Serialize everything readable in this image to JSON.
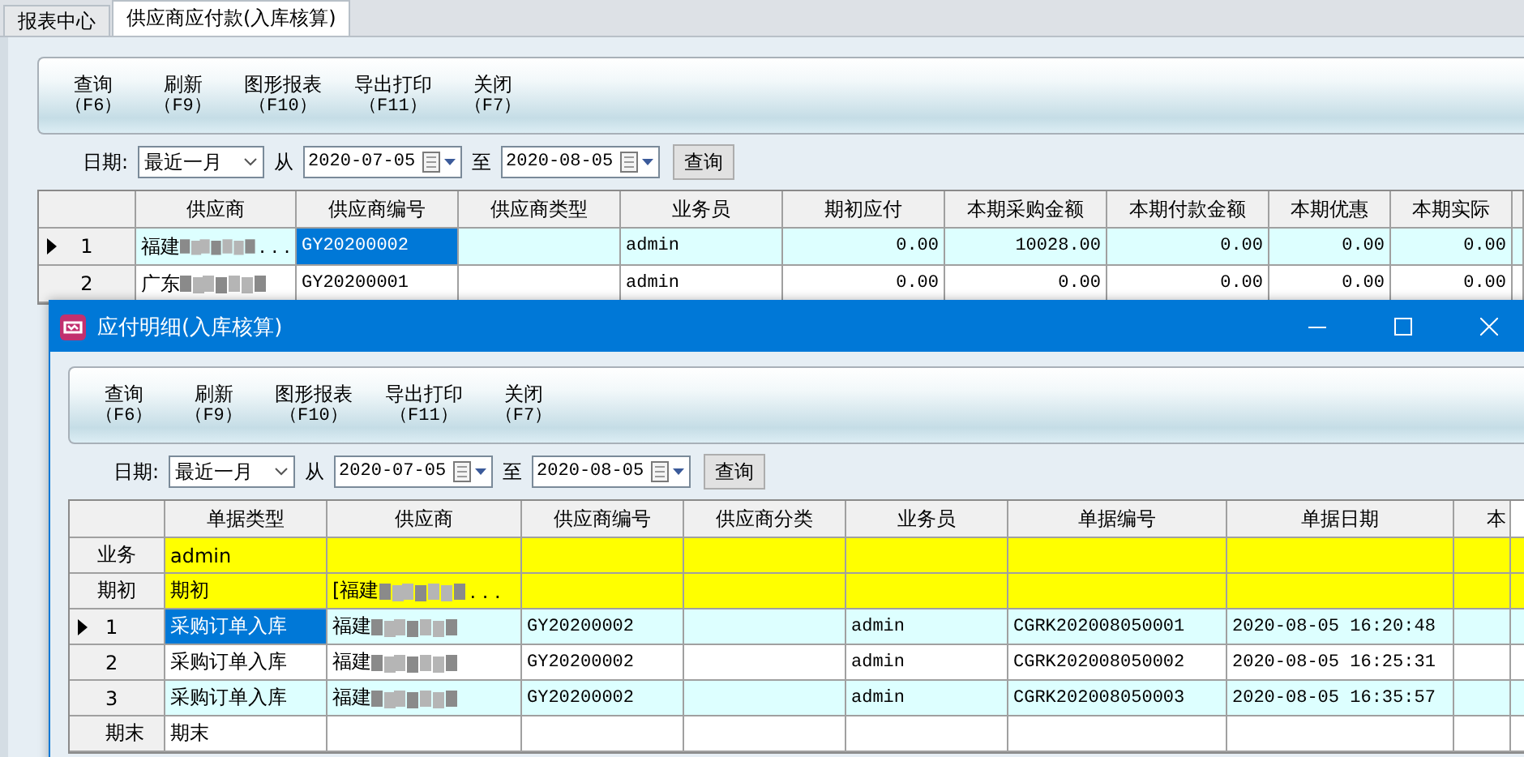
{
  "tabs": [
    {
      "label": "报表中心",
      "selected": false
    },
    {
      "label": "供应商应付款(入库核算)",
      "selected": true
    }
  ],
  "main": {
    "toolbar": [
      {
        "label": "查询",
        "key": "（F6）"
      },
      {
        "label": "刷新",
        "key": "（F9）"
      },
      {
        "label": "图形报表",
        "key": "（F10）"
      },
      {
        "label": "导出打印",
        "key": "（F11）"
      },
      {
        "label": "关闭",
        "key": "（F7）"
      }
    ],
    "filter": {
      "label": "日期:",
      "range": "最近一月",
      "from_label": "从",
      "from": "2020-07-05",
      "to_label": "至",
      "to": "2020-08-05",
      "button": "查询"
    },
    "table": {
      "columns": [
        {
          "label": "供应商",
          "kind": "name"
        },
        {
          "label": "供应商编号",
          "kind": "code"
        },
        {
          "label": "供应商类型",
          "kind": "name"
        },
        {
          "label": "业务员",
          "kind": "code"
        },
        {
          "label": "期初应付",
          "kind": "amount"
        },
        {
          "label": "本期采购金额",
          "kind": "amount"
        },
        {
          "label": "本期付款金额",
          "kind": "amount"
        },
        {
          "label": "本期优惠",
          "kind": "amount"
        },
        {
          "label": "本期实际",
          "kind": "amount"
        }
      ],
      "rows": [
        {
          "header": "1",
          "current": true,
          "color": "#ddffff",
          "cells": [
            {
              "text": "福建",
              "redacted": true,
              "trail": ". . .",
              "selected": false
            },
            {
              "text": "GY20200002",
              "selected": true
            },
            {
              "selected": false
            },
            {
              "text": "admin",
              "selected": false
            },
            {
              "text": "0.00",
              "selected": false
            },
            {
              "text": "10028.00",
              "selected": false
            },
            {
              "text": "0.00",
              "selected": false
            },
            {
              "text": "0.00",
              "selected": false
            },
            {
              "text": "0.00",
              "selected": false
            }
          ]
        },
        {
          "header": "2",
          "current": false,
          "color": "#ffffff",
          "cells": [
            {
              "text": "广东",
              "redacted": true,
              "selected": false
            },
            {
              "text": "GY20200001",
              "selected": false
            },
            {
              "selected": false
            },
            {
              "text": "admin",
              "selected": false
            },
            {
              "text": "0.00",
              "selected": false
            },
            {
              "text": "0.00",
              "selected": false
            },
            {
              "text": "0.00",
              "selected": false
            },
            {
              "text": "0.00",
              "selected": false
            },
            {
              "text": "0.00",
              "selected": false
            }
          ]
        }
      ]
    }
  },
  "dialog": {
    "title": "应付明细(入库核算)",
    "toolbar": [
      {
        "label": "查询",
        "key": "（F6）"
      },
      {
        "label": "刷新",
        "key": "（F9）"
      },
      {
        "label": "图形报表",
        "key": "（F10）"
      },
      {
        "label": "导出打印",
        "key": "（F11）"
      },
      {
        "label": "关闭",
        "key": "（F7）"
      }
    ],
    "filter": {
      "label": "日期:",
      "range": "最近一月",
      "from_label": "从",
      "from": "2020-07-05",
      "to_label": "至",
      "to": "2020-08-05",
      "button": "查询"
    },
    "table": {
      "columns": [
        {
          "label": "单据类型",
          "kind": "name"
        },
        {
          "label": "供应商",
          "kind": "name"
        },
        {
          "label": "供应商编号",
          "kind": "code"
        },
        {
          "label": "供应商分类",
          "kind": "name"
        },
        {
          "label": "业务员",
          "kind": "code"
        },
        {
          "label": "单据编号",
          "kind": "code"
        },
        {
          "label": "单据日期",
          "kind": "code"
        },
        {
          "label": "本",
          "kind": "name"
        }
      ],
      "rows": [
        {
          "header": "业务",
          "current": false,
          "color": "#ffff00",
          "cells": [
            {
              "text": "admin",
              "selected": false
            },
            {
              "selected": false
            },
            {
              "selected": false
            },
            {
              "selected": false
            },
            {
              "selected": false
            },
            {
              "selected": false
            },
            {
              "selected": false
            },
            {
              "selected": false
            }
          ]
        },
        {
          "header": "期初",
          "current": false,
          "color": "#ffff00",
          "cells": [
            {
              "text": "期初",
              "selected": false
            },
            {
              "text": "[福建",
              "redacted": true,
              "trail": ". . .",
              "selected": false
            },
            {
              "selected": false
            },
            {
              "selected": false
            },
            {
              "selected": false
            },
            {
              "selected": false
            },
            {
              "selected": false
            },
            {
              "selected": false
            }
          ]
        },
        {
          "header": "1",
          "current": true,
          "color": "#ddffff",
          "cells": [
            {
              "text": "采购订单入库",
              "selected": true
            },
            {
              "text": "福建",
              "redacted": true,
              "selected": false
            },
            {
              "text": "GY20200002",
              "selected": false
            },
            {
              "selected": false
            },
            {
              "text": "admin",
              "selected": false
            },
            {
              "text": "CGRK202008050001",
              "selected": false
            },
            {
              "text": "2020-08-05 16:20:48",
              "selected": false
            },
            {
              "selected": false
            }
          ]
        },
        {
          "header": "2",
          "current": false,
          "color": "#ffffff",
          "cells": [
            {
              "text": "采购订单入库",
              "selected": false
            },
            {
              "text": "福建",
              "redacted": true,
              "selected": false
            },
            {
              "text": "GY20200002",
              "selected": false
            },
            {
              "selected": false
            },
            {
              "text": "admin",
              "selected": false
            },
            {
              "text": "CGRK202008050002",
              "selected": false
            },
            {
              "text": "2020-08-05 16:25:31",
              "selected": false
            },
            {
              "selected": false
            }
          ]
        },
        {
          "header": "3",
          "current": false,
          "color": "#ddffff",
          "cells": [
            {
              "text": "采购订单入库",
              "selected": false
            },
            {
              "text": "福建",
              "redacted": true,
              "selected": false
            },
            {
              "text": "GY20200002",
              "selected": false
            },
            {
              "selected": false
            },
            {
              "text": "admin",
              "selected": false
            },
            {
              "text": "CGRK202008050003",
              "selected": false
            },
            {
              "text": "2020-08-05 16:35:57",
              "selected": false
            },
            {
              "selected": false
            }
          ]
        },
        {
          "header": "期末",
          "current": false,
          "color": "#ffffff",
          "cells": [
            {
              "text": "期末",
              "selected": false
            },
            {
              "selected": false
            },
            {
              "selected": false
            },
            {
              "selected": false
            },
            {
              "selected": false
            },
            {
              "selected": false
            },
            {
              "selected": false
            },
            {
              "selected": false
            }
          ]
        }
      ]
    }
  }
}
